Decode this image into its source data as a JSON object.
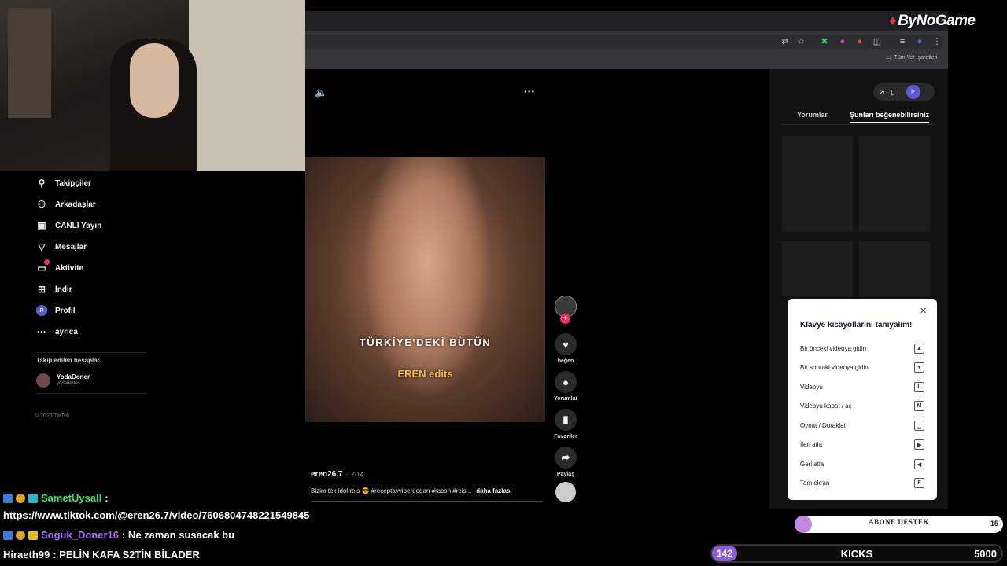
{
  "brand": {
    "logo_text": "ByNoGame"
  },
  "browser": {
    "bookmarks_label": "Tüm Yer İşaretleri"
  },
  "sidebar": {
    "items": [
      {
        "label": "Takipçiler",
        "icon": "user-plus-icon"
      },
      {
        "label": "Arkadaşlar",
        "icon": "friends-icon"
      },
      {
        "label": "CANLI Yayın",
        "icon": "live-icon"
      },
      {
        "label": "Mesajlar",
        "icon": "send-icon"
      },
      {
        "label": "Aktivite",
        "icon": "activity-icon"
      },
      {
        "label": "İndir",
        "icon": "download-icon"
      },
      {
        "label": "Profil",
        "icon": "profile-icon"
      },
      {
        "label": "ayrıca",
        "icon": "more-icon"
      }
    ],
    "followed_header": "Takip edilen hesaplar",
    "followed_accounts": [
      {
        "name": "YodaDerler",
        "handle": "yodaderler"
      }
    ],
    "footer": "© 2026 TikTok"
  },
  "video": {
    "overlay_text_1": "TÜRKİYE'DEKİ BÜTÜN",
    "overlay_text_2": "EREN edits",
    "author": "eren26.7",
    "date": "2-14",
    "caption": "Bizim tek idol reis 😎 #receptayyiperdogan #racon #reis...",
    "more": "daha fazlası"
  },
  "actions": [
    {
      "label": "beğen",
      "icon": "heart-icon"
    },
    {
      "label": "Yorumlar",
      "icon": "comment-icon"
    },
    {
      "label": "Favoriler",
      "icon": "bookmark-icon"
    },
    {
      "label": "Paylaş",
      "icon": "share-icon"
    }
  ],
  "right_panel": {
    "tabs": [
      "Yorumlar",
      "Şunları beğenebilirsiniz"
    ],
    "active_tab": 1
  },
  "shortcuts": {
    "title": "Klavye kısayollarını tanıyalım!",
    "rows": [
      {
        "label": "Bir önceki videoya gidin",
        "key": "▲"
      },
      {
        "label": "Bir sonraki videoya gidin",
        "key": "▼"
      },
      {
        "label": "Videoyu",
        "key": "L"
      },
      {
        "label": "Videoyu kapat / aç",
        "key": "M"
      },
      {
        "label": "Oynat / Duraklat",
        "key": "␣"
      },
      {
        "label": "İleri atla",
        "key": "▶"
      },
      {
        "label": "Geri atla",
        "key": "◀"
      },
      {
        "label": "Tam ekran",
        "key": "F"
      }
    ]
  },
  "chat": {
    "messages": [
      {
        "user": "SametUysall",
        "text": ":",
        "color": "#3fe06b"
      },
      {
        "user": "",
        "text": "https://www.tiktok.com/@eren26.7/video/7606804748221549845",
        "color": "#ffffff"
      },
      {
        "user": "Soguk_Doner16",
        "text": ": Ne zaman susacak bu",
        "color": "#a970ff"
      },
      {
        "user": "Hiraeth99",
        "text": ": PELİN KAFA S2TİN BİLADER",
        "color": "#ffffff"
      }
    ]
  },
  "overlay": {
    "abone_label": "ABONE DESTEK",
    "abone_count": "15",
    "abone_progress": 0.04,
    "kicks_count": "142",
    "kicks_label": "KICKS",
    "kicks_goal": "5000",
    "accent": "#8e5bd6"
  }
}
